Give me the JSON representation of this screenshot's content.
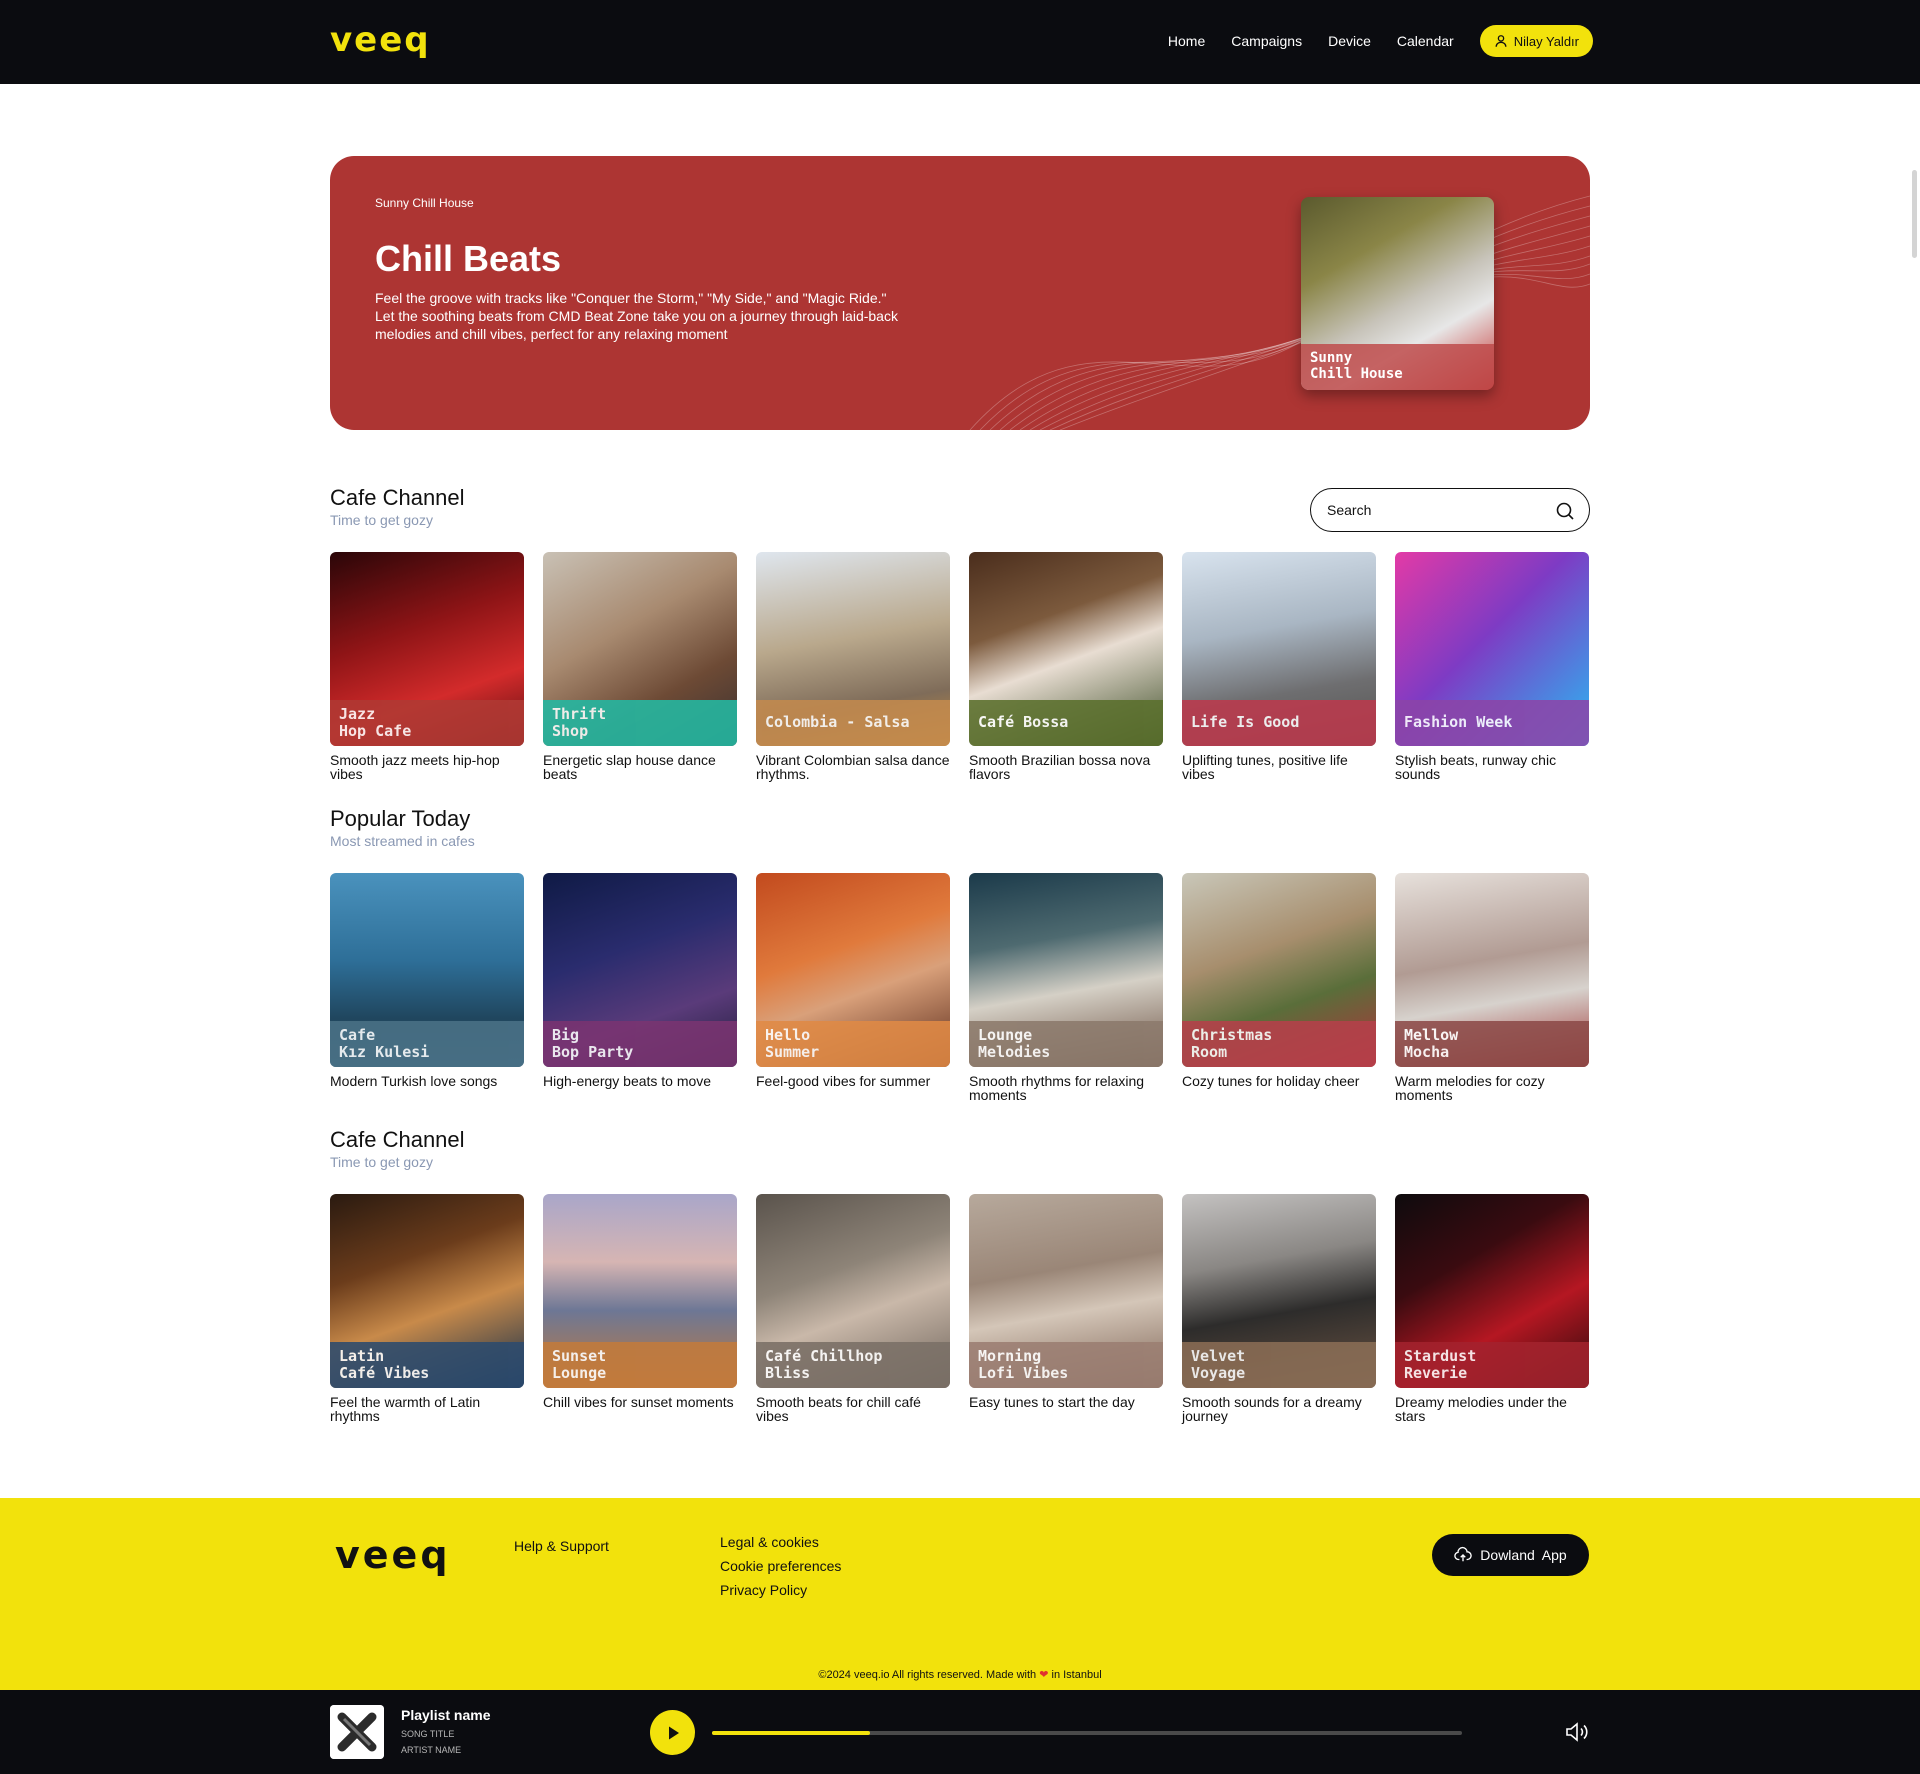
{
  "header": {
    "logo": "veeq",
    "nav": [
      "Home",
      "Campaigns",
      "Device",
      "Calendar"
    ],
    "user": "Nilay Yaldır"
  },
  "hero": {
    "eyebrow": "Sunny Chill House",
    "title": "Chill Beats",
    "description": "Feel the groove with tracks like \"Conquer the Storm,\" \"My Side,\" and \"Magic Ride.\" Let the soothing beats from CMD Beat Zone take you on a journey through laid-back melodies and chill vibes, perfect for any relaxing moment",
    "card_label": "Sunny\nChill House",
    "color": "#ad3533"
  },
  "search": {
    "placeholder": "Search"
  },
  "sections": [
    {
      "title": "Cafe Channel",
      "subtitle": "Time to get gozy",
      "cards": [
        {
          "label": "Jazz\nHop Cafe",
          "caption": "Smooth jazz meets hip-hop vibes",
          "band": "#b03a34"
        },
        {
          "label": "Thrift\nShop",
          "caption": "Energetic slap house dance beats",
          "band": "#23b9a3"
        },
        {
          "label": "Colombia - Salsa",
          "caption": "Vibrant Colombian salsa dance rhythms.",
          "band": "#c38a4e"
        },
        {
          "label": "Café Bossa",
          "caption": "Smooth Brazilian bossa nova flavors",
          "band": "#5a6f2c"
        },
        {
          "label": "Life Is Good",
          "caption": "Uplifting tunes, positive life vibes",
          "band": "#bb3a4d"
        },
        {
          "label": "Fashion Week",
          "caption": "Stylish beats, runway chic sounds",
          "band": "#8b45a8"
        }
      ]
    },
    {
      "title": "Popular Today",
      "subtitle": "Most streamed in cafes",
      "cards": [
        {
          "label": "Cafe\nKız Kulesi",
          "caption": "Modern Turkish love songs",
          "band": "#4a7186"
        },
        {
          "label": "Big\nBop Party",
          "caption": "High-energy beats to move",
          "band": "#7a3471"
        },
        {
          "label": "Hello\nSummer",
          "caption": "Feel-good vibes for summer",
          "band": "#e08a45"
        },
        {
          "label": "Lounge\nMelodies",
          "caption": "Smooth rhythms for relaxing moments",
          "band": "#8c7a6c"
        },
        {
          "label": "Christmas\nRoom",
          "caption": "Cozy tunes for holiday cheer",
          "band": "#b5404a"
        },
        {
          "label": "Mellow\nMocha",
          "caption": "Warm melodies for cozy moments",
          "band": "#8c4a48"
        }
      ]
    },
    {
      "title": "Cafe Channel",
      "subtitle": "Time to get gozy",
      "cards": [
        {
          "label": "Latin\nCafé Vibes",
          "caption": "Feel the warmth of Latin rhythms",
          "band": "#2c4b6e"
        },
        {
          "label": "Sunset\nLounge",
          "caption": "Chill vibes for sunset moments",
          "band": "#c27a3c"
        },
        {
          "label": "Café Chillhop\nBliss",
          "caption": "Smooth beats for chill café vibes",
          "band": "#7a6f66"
        },
        {
          "label": "Morning\nLofi Vibes",
          "caption": "Easy tunes to start the day",
          "band": "#9b7e72"
        },
        {
          "label": "Velvet\nVoyage",
          "caption": "Smooth sounds for a dreamy journey",
          "band": "#8a6d55"
        },
        {
          "label": "Stardust\nReverie",
          "caption": "Dreamy melodies under the stars",
          "band": "#a3232e"
        }
      ]
    }
  ],
  "footer": {
    "logo": "veeq",
    "help": "Help & Support",
    "links": [
      "Legal & cookies",
      "Cookie preferences",
      "Privacy Policy"
    ],
    "download": "Dowland  App",
    "copyright_pre": "©2024 veeq.io All rights reserved. Made with ",
    "copyright_post": " in Istanbul"
  },
  "player": {
    "playlist": "Playlist name",
    "song": "SONG TITLE",
    "artist": "ARTIST NAME",
    "progress": 0.21
  },
  "colors": {
    "brand_yellow": "#f2e20c",
    "dark": "#0b0c10"
  }
}
